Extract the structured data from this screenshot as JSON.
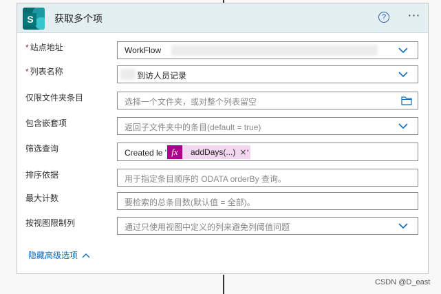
{
  "card": {
    "title": "获取多个项",
    "help_symbol": "?",
    "more_symbol": "···"
  },
  "fields": {
    "site": {
      "label": "站点地址",
      "required_mark": "*",
      "value": "WorkFlow"
    },
    "list": {
      "label": "列表名称",
      "required_mark": "*",
      "value": "到访人员记录"
    },
    "folder": {
      "label": "仅限文件夹条目",
      "placeholder": "选择一个文件夹，或对整个列表留空"
    },
    "nested": {
      "label": "包含嵌套项",
      "placeholder": "返回子文件夹中的条目(default = true)"
    },
    "filter": {
      "label": "筛选查询",
      "value_prefix": "Created le '",
      "value_suffix": "'",
      "token_icon": "fx",
      "token_label": "addDays(...)",
      "token_remove": "×"
    },
    "order": {
      "label": "排序依据",
      "placeholder": "用于指定条目顺序的 ODATA orderBy 查询。"
    },
    "top": {
      "label": "最大计数",
      "placeholder": "要检索的总条目数(默认值 = 全部)。"
    },
    "view": {
      "label": "按视图限制列",
      "placeholder": "通过只使用视图中定义的列来避免列阈值问题"
    }
  },
  "advanced": {
    "label": "隐藏高级选项"
  },
  "watermark": "CSDN @D_east",
  "colors": {
    "accent": "#0f6cbd",
    "header": "#e3eff1",
    "token": "#ad008c",
    "required": "#a4262c"
  }
}
